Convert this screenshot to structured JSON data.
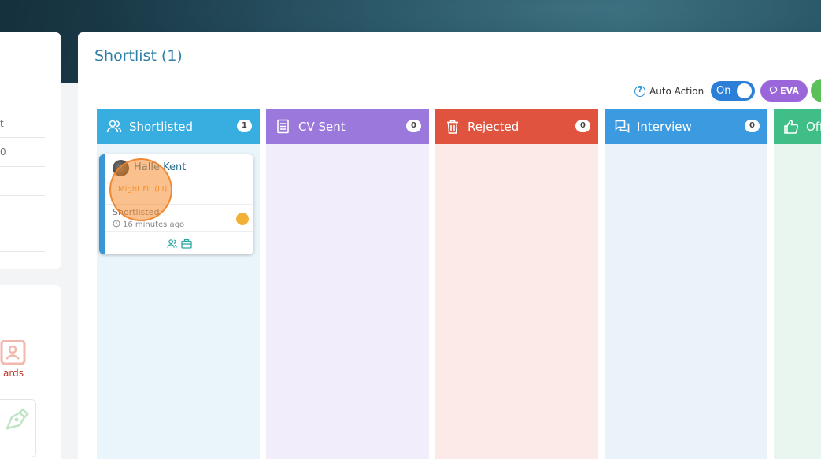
{
  "left_panel": {
    "rows": [
      "t",
      "0",
      "",
      "",
      ""
    ],
    "rewards_label": "ards"
  },
  "main": {
    "title": "Shortlist (1)",
    "auto_action_label": "Auto Action",
    "help_symbol": "?",
    "toggle_label": "On",
    "eva_label": "EVA"
  },
  "columns": [
    {
      "name": "Shortlisted",
      "count": "1",
      "color": "#38aee0",
      "body": "#eaf5fb",
      "icon": "users-icon"
    },
    {
      "name": "CV Sent",
      "count": "0",
      "color": "#9b78dc",
      "body": "#f1edfb",
      "icon": "document-icon"
    },
    {
      "name": "Rejected",
      "count": "0",
      "color": "#e0533f",
      "body": "#fbeae8",
      "icon": "trash-icon"
    },
    {
      "name": "Interview",
      "count": "0",
      "color": "#3c9be0",
      "body": "#eaf2fa",
      "icon": "chat-icon"
    },
    {
      "name": "Off",
      "count": "",
      "color": "#3fbf87",
      "body": "#e8f6ef",
      "icon": "thumbs-up-icon"
    }
  ],
  "card": {
    "candidate_name": "Halle Kent",
    "fit_label": "Might Fit (LI)",
    "stage": "Shortlisted",
    "time_ago": "16 minutes ago",
    "status_color": "#f2b134"
  }
}
